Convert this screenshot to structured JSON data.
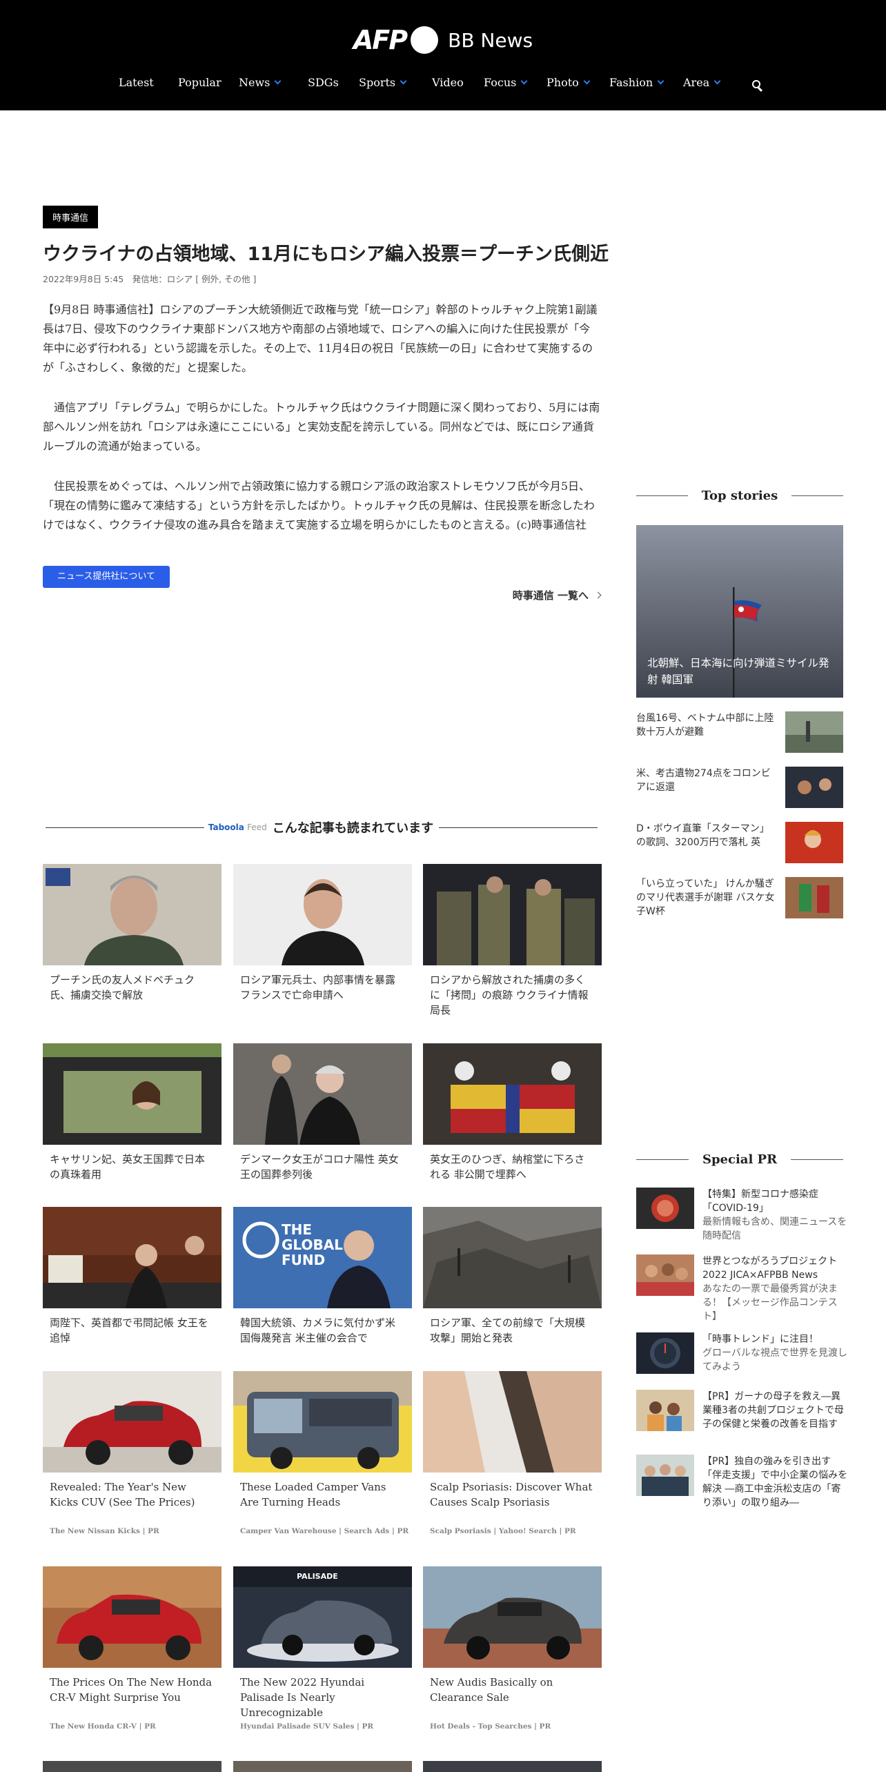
{
  "header": {
    "logo_afp": "AFP",
    "logo_bb": "BB News",
    "nav": [
      {
        "label": "Latest",
        "dropdown": false
      },
      {
        "label": "Popular",
        "dropdown": false
      },
      {
        "label": "News",
        "dropdown": true
      },
      {
        "label": "SDGs",
        "dropdown": false
      },
      {
        "label": "Sports",
        "dropdown": true
      },
      {
        "label": "Video",
        "dropdown": false
      },
      {
        "label": "Focus",
        "dropdown": true
      },
      {
        "label": "Photo",
        "dropdown": true
      },
      {
        "label": "Fashion",
        "dropdown": true
      },
      {
        "label": "Area",
        "dropdown": true
      }
    ]
  },
  "article": {
    "source": "時事通信",
    "title": "ウクライナの占領地域、11月にもロシア編入投票＝プーチン氏側近",
    "meta": "2022年9月8日 5:45　発信地：ロシア [ 例外, その他 ]",
    "paragraphs": [
      "【9月8日 時事通信社】ロシアのプーチン大統領側近で政権与党「統一ロシア」幹部のトゥルチャク上院第1副議長は7日、侵攻下のウクライナ東部ドンバス地方や南部の占領地域で、ロシアへの編入に向けた住民投票が「今年中に必ず行われる」という認識を示した。その上で、11月4日の祝日「民族統一の日」に合わせて実施するのが「ふさわしく、象徴的だ」と提案した。",
      "　通信アプリ「テレグラム」で明らかにした。トゥルチャク氏はウクライナ問題に深く関わっており、5月には南部ヘルソン州を訪れ「ロシアは永遠にここにいる」と実効支配を誇示している。同州などでは、既にロシア通貨ルーブルの流通が始まっている。",
      "　住民投票をめぐっては、ヘルソン州で占領政策に協力する親ロシア派の政治家ストレモウソフ氏が今月5日、「現在の情勢に鑑みて凍結する」という方針を示したばかり。トゥルチャク氏の見解は、住民投票を断念したわけではなく、ウクライナ侵攻の進み具合を踏まえて実施する立場を明らかにしたものと言える。(c)時事通信社"
    ],
    "provider_button": "ニュース提供社について",
    "more_link": "時事通信 一覧へ"
  },
  "taboola": {
    "brand": "Taboola",
    "brand_feed": "Feed",
    "heading": "こんな記事も読まれています",
    "cards": [
      {
        "title": "プーチン氏の友人メドベチュク氏、捕虜交換で解放",
        "source": ""
      },
      {
        "title": "ロシア軍元兵士、内部事情を暴露 フランスで亡命申請へ",
        "source": ""
      },
      {
        "title": "ロシアから解放された捕虜の多くに「拷問」の痕跡 ウクライナ情報局長",
        "source": ""
      },
      {
        "title": "キャサリン妃、英女王国葬で日本の真珠着用",
        "source": ""
      },
      {
        "title": "デンマーク女王がコロナ陽性 英女王の国葬参列後",
        "source": ""
      },
      {
        "title": "英女王のひつぎ、納棺堂に下ろされる 非公開で埋葬へ",
        "source": ""
      },
      {
        "title": "両陛下、英首都で弔問記帳 女王を追悼",
        "source": ""
      },
      {
        "title": "韓国大統領、カメラに気付かず米国侮蔑発言 米主催の会合で",
        "source": ""
      },
      {
        "title": "ロシア軍、全ての前線で「大規模攻撃」開始と発表",
        "source": ""
      },
      {
        "title": "Revealed: The Year's New Kicks CUV (See The Prices)",
        "source": "The New Nissan Kicks | PR"
      },
      {
        "title": "These Loaded Camper Vans Are Turning Heads",
        "source": "Camper Van Warehouse | Search Ads | PR"
      },
      {
        "title": "Scalp Psoriasis: Discover What Causes Scalp Psoriasis",
        "source": "Scalp Psoriasis | Yahoo! Search | PR"
      },
      {
        "title": "The Prices On The New Honda CR-V Might Surprise You",
        "source": "The New Honda CR-V | PR"
      },
      {
        "title": "The New 2022 Hyundai Palisade Is Nearly Unrecognizable",
        "source": "Hyundai Palisade SUV Sales | PR"
      },
      {
        "title": "New Audis Basically on Clearance Sale",
        "source": "Hot Deals - Top Searches | PR"
      }
    ]
  },
  "sidebar": {
    "top_heading": "Top stories",
    "top_main_caption": "北朝鮮、日本海に向け弾道ミサイル発射 韓国軍",
    "stories": [
      "台風16号、ベトナム中部に上陸 数十万人が避難",
      "米、考古遺物274点をコロンビアに返還",
      "D・ボウイ直筆「スターマン」の歌詞、3200万円で落札 英",
      "「いら立っていた」 けんか騒ぎのマリ代表選手が謝罪 バスケ女子W杯"
    ],
    "pr_heading": "Special PR",
    "pr_items": [
      {
        "title": "【特集】新型コロナ感染症「COVID-19」",
        "sub": "最新情報も含め、関連ニュースを随時配信"
      },
      {
        "title": "世界とつながろうプロジェクト2022 JICA×AFPBB News",
        "sub": "あなたの一票で最優秀賞が決まる！【メッセージ作品コンテスト】"
      },
      {
        "title": "「時事トレンド」に注目！",
        "sub": "グローバルな視点で世界を見渡してみよう"
      },
      {
        "title": "【PR】ガーナの母子を救え―異業種3者の共創プロジェクトで母子の保健と栄養の改善を目指す",
        "sub": ""
      },
      {
        "title": "【PR】独自の強みを引き出す「伴走支援」で中小企業の悩みを解決 ―商工中金浜松支店の「寄り添い」の取り組み―",
        "sub": ""
      }
    ]
  }
}
